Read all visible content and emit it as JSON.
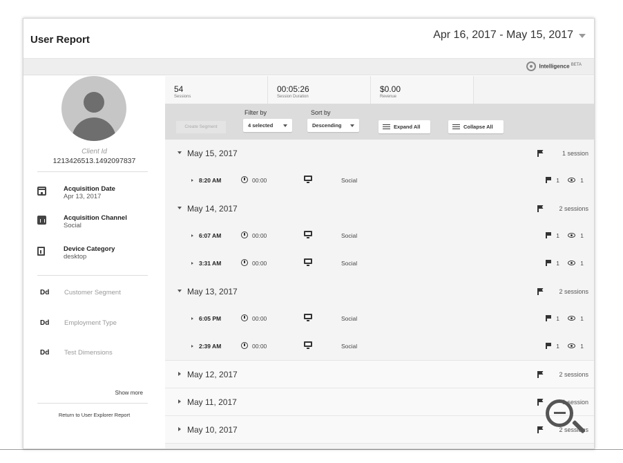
{
  "header": {
    "title": "User Report",
    "date_range": "Apr 16, 2017 - May 15, 2017",
    "intelligence_label": "Intelligence",
    "intelligence_badge": "BETA"
  },
  "profile": {
    "client_id_label": "Client Id",
    "client_id": "1213426513.1492097837",
    "info": [
      {
        "icon": "calendar-icon",
        "title": "Acquisition Date",
        "value": "Apr 13, 2017"
      },
      {
        "icon": "bar-chart-icon",
        "title": "Acquisition Channel",
        "value": "Social"
      },
      {
        "icon": "device-icon",
        "title": "Device Category",
        "value": "desktop"
      }
    ],
    "dimensions": [
      {
        "badge": "Dd",
        "label": "Customer Segment"
      },
      {
        "badge": "Dd",
        "label": "Employment Type"
      },
      {
        "badge": "Dd",
        "label": "Test Dimensions"
      }
    ],
    "show_more": "Show more",
    "return_link": "Return to User Explorer Report"
  },
  "stats": [
    {
      "value": "54",
      "label": "Sessions"
    },
    {
      "value": "00:05:26",
      "label": "Session Duration"
    },
    {
      "value": "$0.00",
      "label": "Revenue"
    }
  ],
  "toolbar": {
    "create_segment": "Create Segment",
    "filter_label": "Filter by",
    "filter_value": "4 selected",
    "sort_label": "Sort by",
    "sort_value": "Descending",
    "expand_all": "Expand All",
    "collapse_all": "Collapse All"
  },
  "dates": [
    {
      "date": "May 15, 2017",
      "count": "1 session",
      "expanded": true,
      "sessions": [
        {
          "time": "8:20 AM",
          "duration": "00:00",
          "channel": "Social",
          "flags": "1",
          "views": "1"
        }
      ]
    },
    {
      "date": "May 14, 2017",
      "count": "2 sessions",
      "expanded": true,
      "sessions": [
        {
          "time": "6:07 AM",
          "duration": "00:00",
          "channel": "Social",
          "flags": "1",
          "views": "1"
        },
        {
          "time": "3:31 AM",
          "duration": "00:00",
          "channel": "Social",
          "flags": "1",
          "views": "1"
        }
      ]
    },
    {
      "date": "May 13, 2017",
      "count": "2 sessions",
      "expanded": true,
      "sessions": [
        {
          "time": "6:05 PM",
          "duration": "00:00",
          "channel": "Social",
          "flags": "1",
          "views": "1"
        },
        {
          "time": "2:39 AM",
          "duration": "00:00",
          "channel": "Social",
          "flags": "1",
          "views": "1"
        }
      ]
    },
    {
      "date": "May 12, 2017",
      "count": "2 sessions",
      "expanded": false,
      "sessions": []
    },
    {
      "date": "May 11, 2017",
      "count": "1 session",
      "expanded": false,
      "sessions": []
    },
    {
      "date": "May 10, 2017",
      "count": "2 sessions",
      "expanded": false,
      "sessions": []
    }
  ]
}
